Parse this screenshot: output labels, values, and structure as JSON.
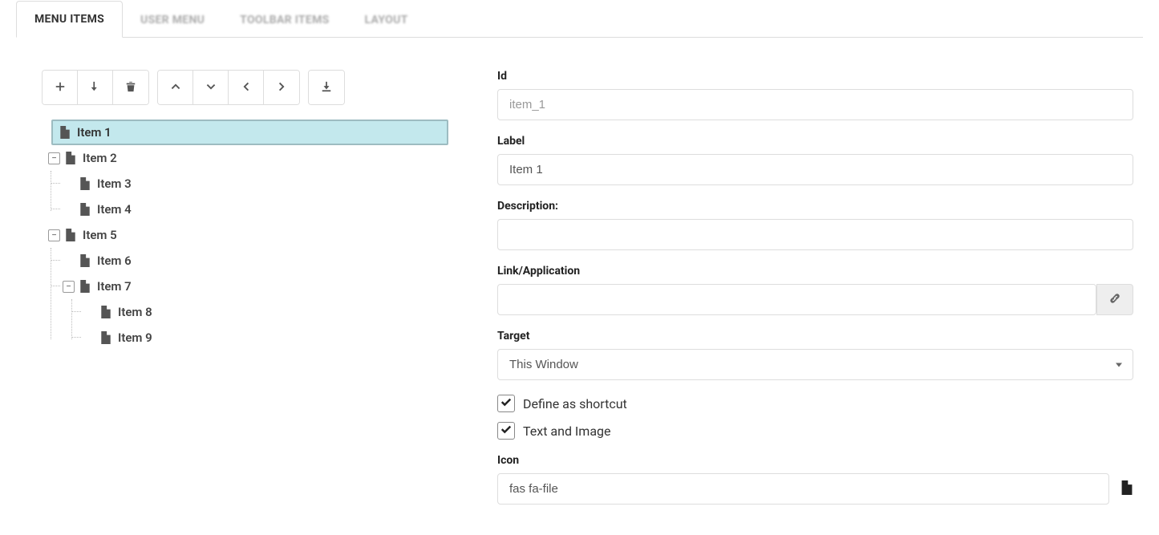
{
  "tabs": [
    {
      "label": "MENU ITEMS",
      "active": true
    },
    {
      "label": "USER MENU",
      "active": false
    },
    {
      "label": "TOOLBAR ITEMS",
      "active": false
    },
    {
      "label": "LAYOUT",
      "active": false
    }
  ],
  "tree": {
    "items": [
      {
        "label": "Item 1",
        "selected": true
      },
      {
        "label": "Item 2",
        "expanded": true,
        "children": [
          {
            "label": "Item 3"
          },
          {
            "label": "Item 4"
          }
        ]
      },
      {
        "label": "Item 5",
        "expanded": true,
        "children": [
          {
            "label": "Item 6"
          },
          {
            "label": "Item 7",
            "expanded": true,
            "children": [
              {
                "label": "Item 8"
              },
              {
                "label": "Item 9"
              }
            ]
          }
        ]
      }
    ]
  },
  "form": {
    "id_label": "Id",
    "id_value": "item_1",
    "label_label": "Label",
    "label_value": "Item 1",
    "description_label": "Description:",
    "description_value": "",
    "link_label": "Link/Application",
    "link_value": "",
    "target_label": "Target",
    "target_value": "This Window",
    "shortcut_label": "Define as shortcut",
    "shortcut_checked": true,
    "textimage_label": "Text and Image",
    "textimage_checked": true,
    "icon_label": "Icon",
    "icon_value": "fas fa-file"
  }
}
